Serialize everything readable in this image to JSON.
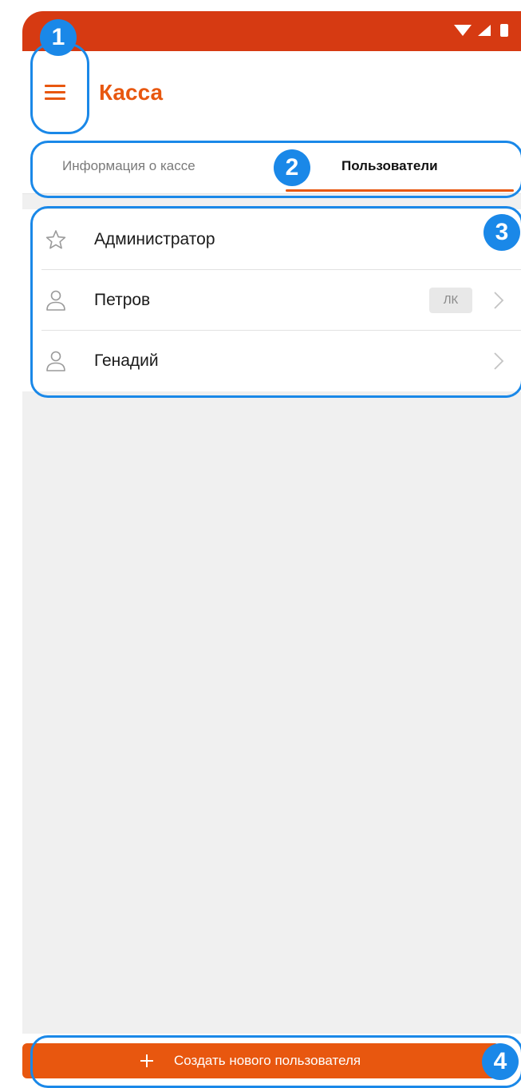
{
  "app": {
    "title": "Касса"
  },
  "tabs": [
    {
      "label": "Информация о кассе",
      "active": false
    },
    {
      "label": "Пользователи",
      "active": true
    }
  ],
  "users": [
    {
      "name": "Администратор",
      "icon": "star-icon",
      "badge": "",
      "chevron": false
    },
    {
      "name": "Петров",
      "icon": "person-icon",
      "badge": "ЛК",
      "chevron": true
    },
    {
      "name": "Генадий",
      "icon": "person-icon",
      "badge": "",
      "chevron": true
    }
  ],
  "create_button": {
    "label": "Создать нового пользователя",
    "icon": "plus-icon"
  },
  "annotations": [
    "1",
    "2",
    "3",
    "4"
  ],
  "colors": {
    "accent": "#e8570f",
    "status_bar": "#d63a12",
    "annotation": "#1a88e8",
    "background": "#f0f0f0"
  }
}
